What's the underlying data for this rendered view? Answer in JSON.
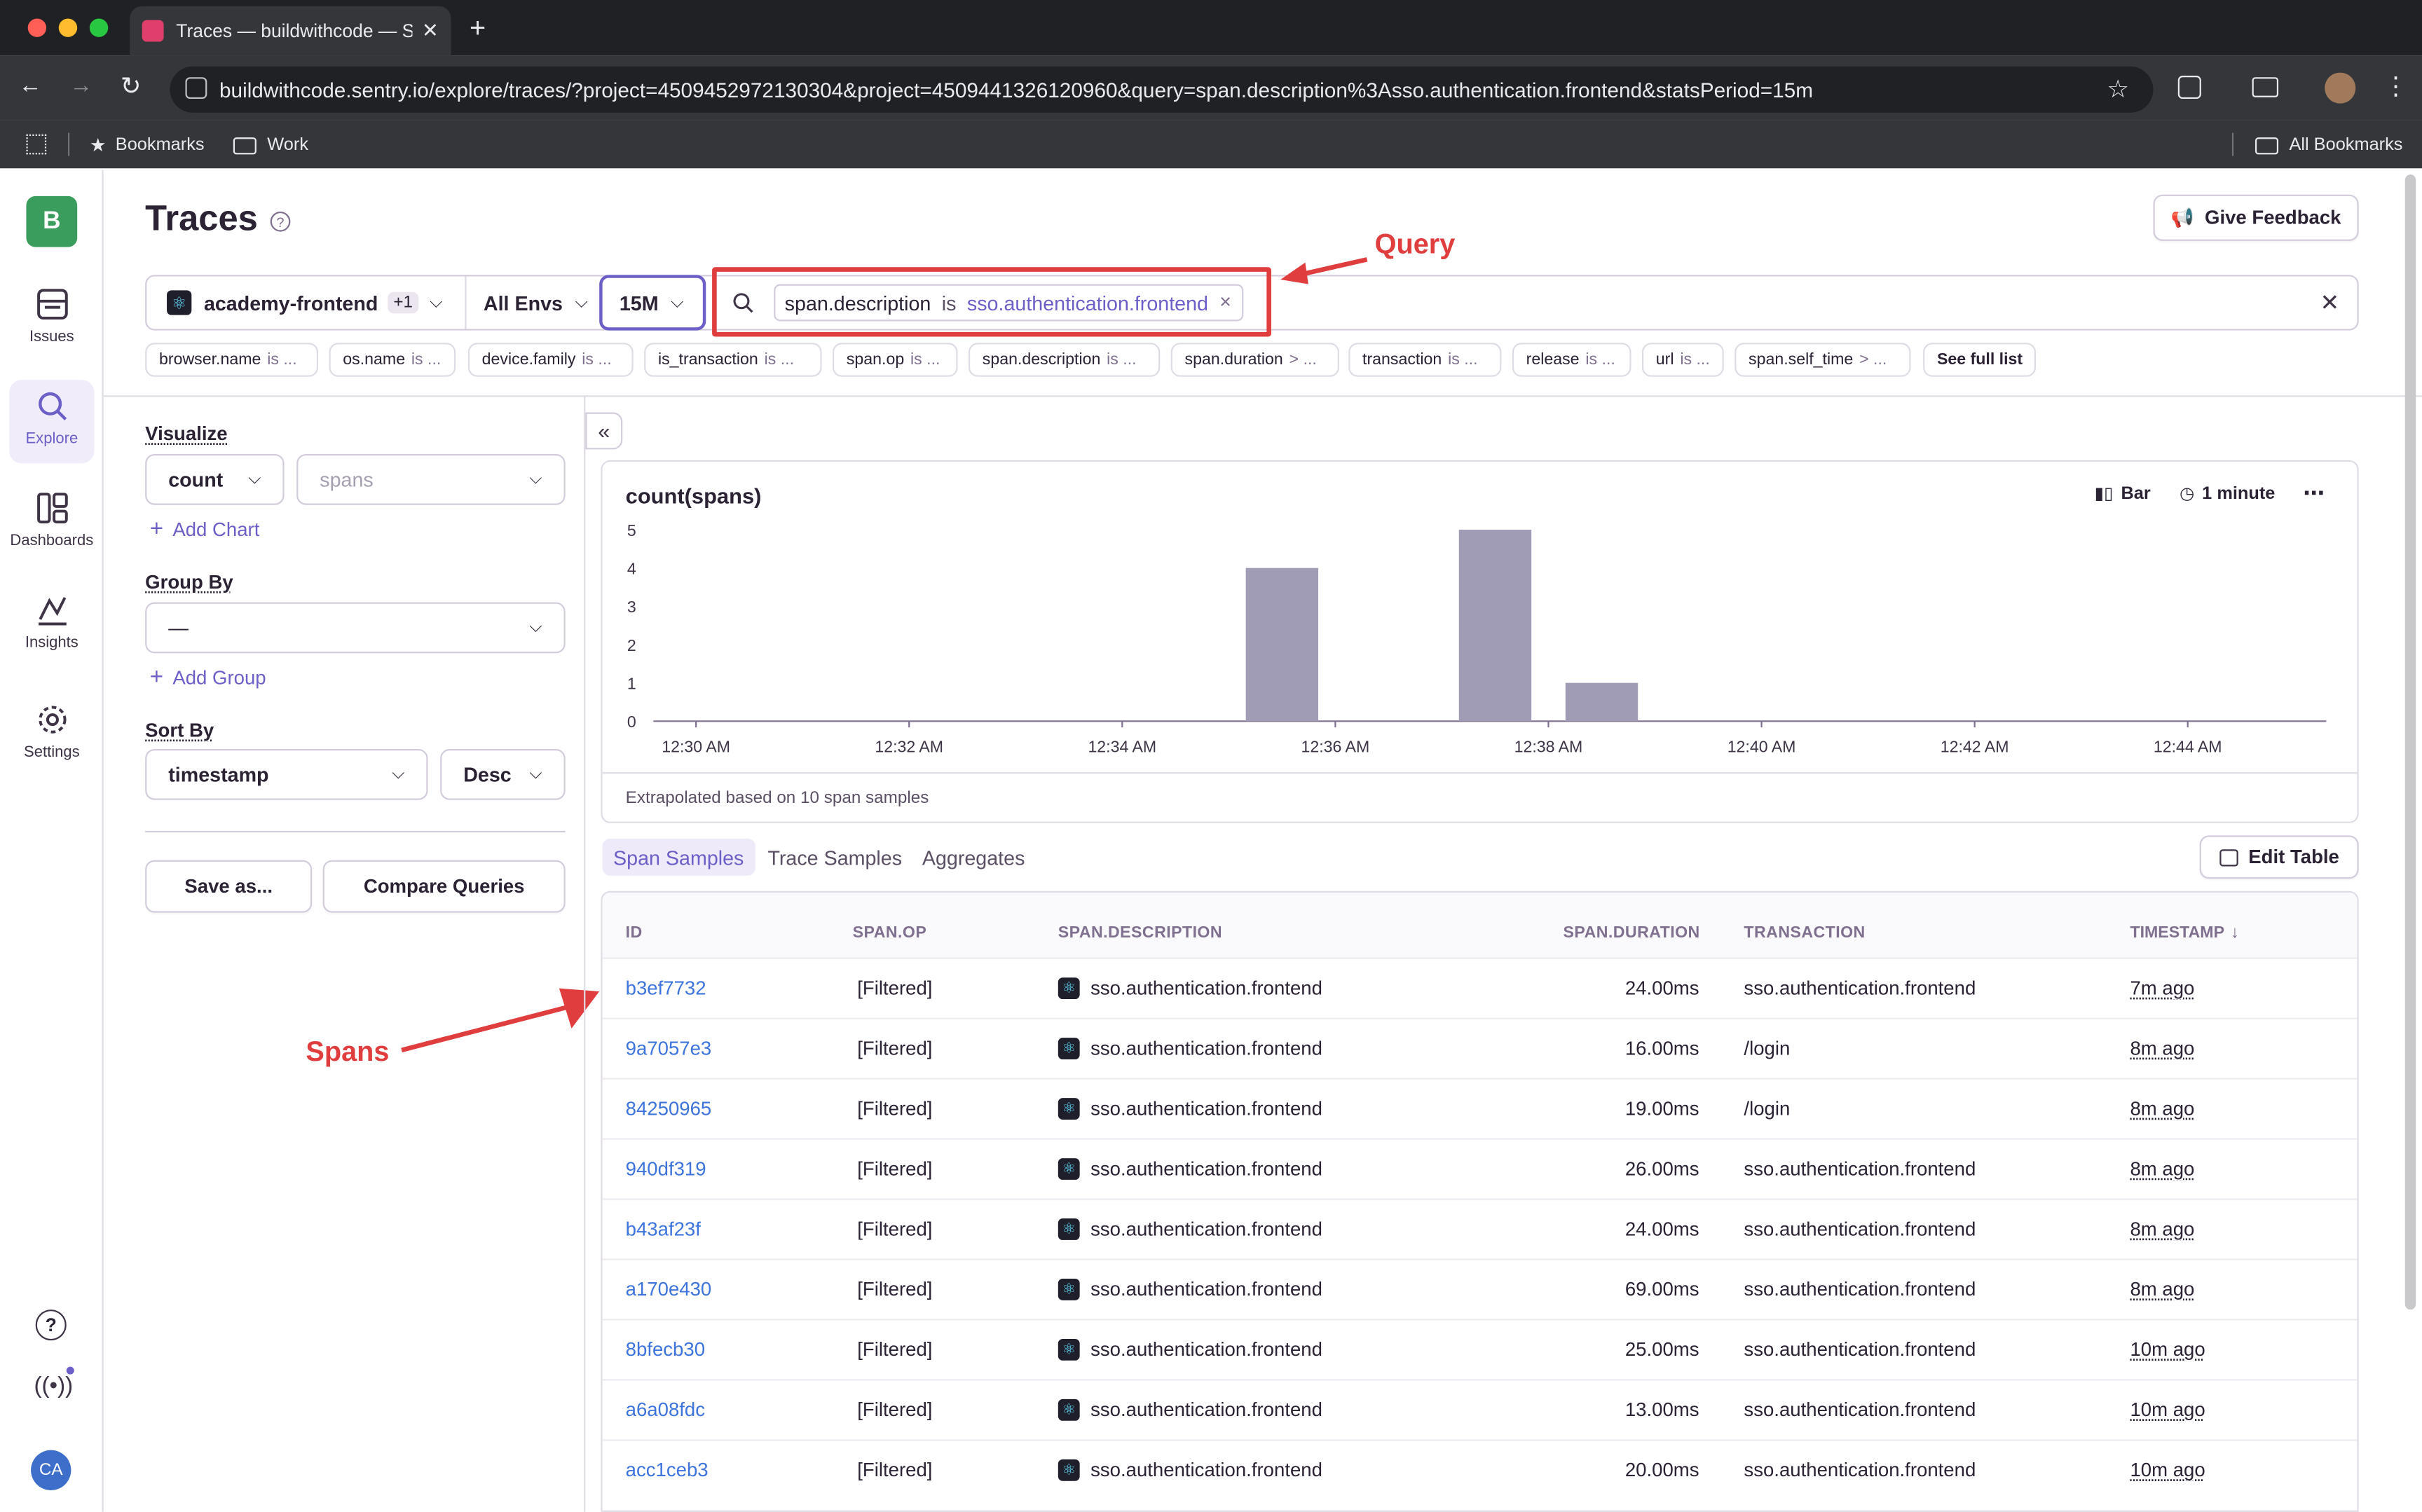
{
  "browser": {
    "tab_title": "Traces — buildwithcode — Se",
    "url": "buildwithcode.sentry.io/explore/traces/?project=4509452972130304&project=4509441326120960&query=span.description%3Asso.authentication.frontend&statsPeriod=15m",
    "bookmarks": [
      {
        "label": "Bookmarks"
      },
      {
        "label": "Work"
      }
    ],
    "all_bookmarks": "All Bookmarks"
  },
  "sidebar": {
    "org_initial": "B",
    "items": [
      {
        "label": "Issues",
        "icon": "issues-icon"
      },
      {
        "label": "Explore",
        "icon": "search-icon",
        "active": true
      },
      {
        "label": "Dashboards",
        "icon": "dashboards-icon"
      },
      {
        "label": "Insights",
        "icon": "insights-icon"
      },
      {
        "label": "Settings",
        "icon": "gear-icon"
      }
    ],
    "avatar": "CA"
  },
  "header": {
    "title": "Traces",
    "feedback": "Give Feedback"
  },
  "filters": {
    "project": "academy-frontend",
    "project_extra": "+1",
    "env": "All Envs",
    "period": "15M",
    "query_key": "span.description",
    "query_op": "is",
    "query_value": "sso.authentication.frontend"
  },
  "suggestions": [
    {
      "key": "browser.name",
      "op": "is ..."
    },
    {
      "key": "os.name",
      "op": "is ..."
    },
    {
      "key": "device.family",
      "op": "is ..."
    },
    {
      "key": "is_transaction",
      "op": "is ..."
    },
    {
      "key": "span.op",
      "op": "is ..."
    },
    {
      "key": "span.description",
      "op": "is ..."
    },
    {
      "key": "span.duration",
      "op": "> ..."
    },
    {
      "key": "transaction",
      "op": "is ..."
    },
    {
      "key": "release",
      "op": "is ..."
    },
    {
      "key": "url",
      "op": "is ..."
    },
    {
      "key": "span.self_time",
      "op": "> ..."
    }
  ],
  "see_full_list": "See full list",
  "panel": {
    "visualize": "Visualize",
    "agg": "count",
    "field": "spans",
    "add_chart": "Add Chart",
    "group_by": "Group By",
    "group_value": "—",
    "add_group": "Add Group",
    "sort_by": "Sort By",
    "sort_field": "timestamp",
    "sort_dir": "Desc",
    "save_as": "Save as...",
    "compare": "Compare Queries"
  },
  "chart_meta": {
    "type_label": "Bar",
    "interval_label": "1 minute",
    "footer": "Extrapolated based on 10 span samples"
  },
  "chart_data": {
    "type": "bar",
    "title": "count(spans)",
    "x_ticks": [
      "12:30 AM",
      "12:32 AM",
      "12:34 AM",
      "12:36 AM",
      "12:38 AM",
      "12:40 AM",
      "12:42 AM",
      "12:44 AM"
    ],
    "categories": [
      "12:35 AM",
      "12:37 AM",
      "12:38 AM"
    ],
    "values": [
      4,
      5,
      1
    ],
    "ylim": [
      0,
      5
    ],
    "y_ticks": [
      "0",
      "1",
      "2",
      "3",
      "4",
      "5"
    ],
    "color": "#a09cb5"
  },
  "tabs": [
    "Span Samples",
    "Trace Samples",
    "Aggregates"
  ],
  "edit_table": "Edit Table",
  "columns": [
    "ID",
    "SPAN.OP",
    "SPAN.DESCRIPTION",
    "SPAN.DURATION",
    "TRANSACTION",
    "TIMESTAMP"
  ],
  "rows": [
    {
      "id": "b3ef7732",
      "op": "[Filtered]",
      "desc": "sso.authentication.frontend",
      "dur": "24.00ms",
      "txn": "sso.authentication.frontend",
      "ts": "7m ago"
    },
    {
      "id": "9a7057e3",
      "op": "[Filtered]",
      "desc": "sso.authentication.frontend",
      "dur": "16.00ms",
      "txn": "/login",
      "ts": "8m ago"
    },
    {
      "id": "84250965",
      "op": "[Filtered]",
      "desc": "sso.authentication.frontend",
      "dur": "19.00ms",
      "txn": "/login",
      "ts": "8m ago"
    },
    {
      "id": "940df319",
      "op": "[Filtered]",
      "desc": "sso.authentication.frontend",
      "dur": "26.00ms",
      "txn": "sso.authentication.frontend",
      "ts": "8m ago"
    },
    {
      "id": "b43af23f",
      "op": "[Filtered]",
      "desc": "sso.authentication.frontend",
      "dur": "24.00ms",
      "txn": "sso.authentication.frontend",
      "ts": "8m ago"
    },
    {
      "id": "a170e430",
      "op": "[Filtered]",
      "desc": "sso.authentication.frontend",
      "dur": "69.00ms",
      "txn": "sso.authentication.frontend",
      "ts": "8m ago"
    },
    {
      "id": "8bfecb30",
      "op": "[Filtered]",
      "desc": "sso.authentication.frontend",
      "dur": "25.00ms",
      "txn": "sso.authentication.frontend",
      "ts": "10m ago"
    },
    {
      "id": "a6a08fdc",
      "op": "[Filtered]",
      "desc": "sso.authentication.frontend",
      "dur": "13.00ms",
      "txn": "sso.authentication.frontend",
      "ts": "10m ago"
    },
    {
      "id": "acc1ceb3",
      "op": "[Filtered]",
      "desc": "sso.authentication.frontend",
      "dur": "20.00ms",
      "txn": "sso.authentication.frontend",
      "ts": "10m ago"
    }
  ],
  "annotations": {
    "query": "Query",
    "spans": "Spans"
  },
  "colors": {
    "accent": "#6c5fc7",
    "annotation": "#e03e3e",
    "link": "#3d74db"
  }
}
